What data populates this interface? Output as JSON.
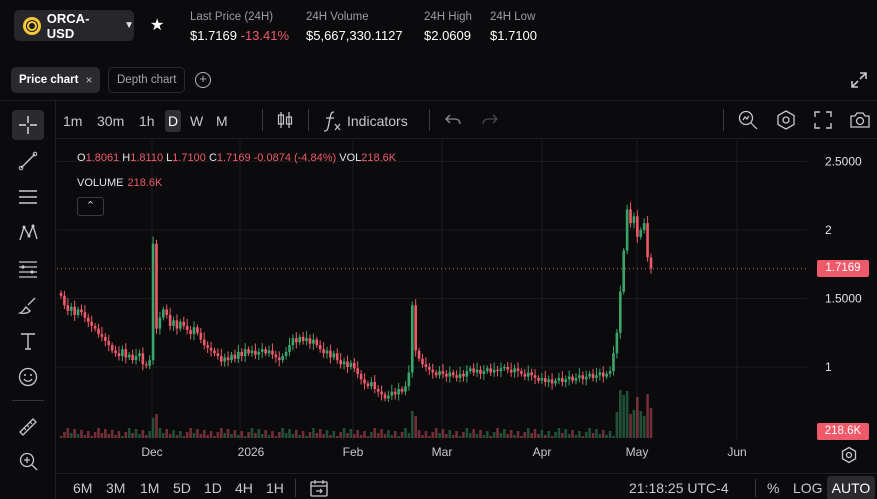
{
  "header": {
    "market": "ORCA-USD",
    "stats": [
      {
        "label": "Last Price (24H)",
        "value": "$1.7169",
        "change": "-13.41%"
      },
      {
        "label": "24H Volume",
        "value": "$5,667,330.1127"
      },
      {
        "label": "24H High",
        "value": "$2.0609"
      },
      {
        "label": "24H Low",
        "value": "$1.7100"
      }
    ]
  },
  "tabs": {
    "price": "Price chart",
    "depth": "Depth chart",
    "close": "×"
  },
  "toolbar": {
    "timeframes": [
      "1m",
      "30m",
      "1h",
      "D",
      "W",
      "M"
    ],
    "selected": "D",
    "indicators": "Indicators"
  },
  "legend": {
    "o_key": "O",
    "o_val": "1.8061",
    "h_key": "H",
    "h_val": "1.8110",
    "l_key": "L",
    "l_val": "1.7100",
    "c_key": "C",
    "c_val": "1.7169",
    "change": "-0.0874 (-4.84%)",
    "vol_key": "VOL",
    "vol_val": "218.6K",
    "volume_label": "VOLUME",
    "volume_val": "218.6K"
  },
  "price_tag": "1.7169",
  "volume_tag": "218.6K",
  "bottom": {
    "ranges": [
      "6M",
      "3M",
      "1M",
      "5D",
      "1D",
      "4H",
      "1H"
    ],
    "clock": "21:18:25 UTC-4",
    "percent": "%",
    "log": "LOG",
    "auto": "AUTO"
  },
  "chart_data": {
    "type": "candlestick",
    "y_ticks": [
      "2.5000",
      "2",
      "1.5000",
      "1"
    ],
    "x_ticks": [
      "Dec",
      "2026",
      "Feb",
      "Mar",
      "Apr",
      "May",
      "Jun"
    ],
    "last_price": 1.7169,
    "colors": {
      "up": "#3aa56a",
      "down": "#ef5a6a",
      "grid": "#1c1c20"
    },
    "closes": [
      1.52,
      1.45,
      1.41,
      1.44,
      1.38,
      1.42,
      1.4,
      1.36,
      1.33,
      1.3,
      1.28,
      1.24,
      1.22,
      1.19,
      1.16,
      1.12,
      1.1,
      1.08,
      1.13,
      1.07,
      1.09,
      1.05,
      1.08,
      1.1,
      1.02,
      1.01,
      1.05,
      1.9,
      1.28,
      1.36,
      1.42,
      1.38,
      1.3,
      1.34,
      1.28,
      1.33,
      1.3,
      1.27,
      1.24,
      1.29,
      1.25,
      1.2,
      1.16,
      1.14,
      1.12,
      1.1,
      1.08,
      1.04,
      1.07,
      1.05,
      1.09,
      1.06,
      1.11,
      1.08,
      1.13,
      1.1,
      1.12,
      1.09,
      1.11,
      1.13,
      1.1,
      1.12,
      1.09,
      1.07,
      1.05,
      1.08,
      1.11,
      1.16,
      1.21,
      1.18,
      1.22,
      1.19,
      1.21,
      1.17,
      1.2,
      1.16,
      1.13,
      1.1,
      1.12,
      1.07,
      1.1,
      1.05,
      1.02,
      1.04,
      1.0,
      1.03,
      0.99,
      0.95,
      0.91,
      0.88,
      0.86,
      0.89,
      0.84,
      0.82,
      0.8,
      0.77,
      0.79,
      0.82,
      0.8,
      0.84,
      0.82,
      0.86,
      0.96,
      1.45,
      1.12,
      1.06,
      1.02,
      1.0,
      0.98,
      0.96,
      0.94,
      0.97,
      0.95,
      0.93,
      0.96,
      0.94,
      0.92,
      0.95,
      0.93,
      0.97,
      0.99,
      0.96,
      0.98,
      0.95,
      0.97,
      0.99,
      0.96,
      0.98,
      0.97,
      0.99,
      1.0,
      0.98,
      0.96,
      0.99,
      0.97,
      0.95,
      0.93,
      0.96,
      0.94,
      0.92,
      0.9,
      0.92,
      0.89,
      0.91,
      0.88,
      0.9,
      0.92,
      0.89,
      0.91,
      0.93,
      0.9,
      0.92,
      0.94,
      0.91,
      0.93,
      0.95,
      0.92,
      0.94,
      0.96,
      0.93,
      0.95,
      0.97,
      1.1,
      1.25,
      1.55,
      1.85,
      2.15,
      2.05,
      2.1,
      1.95,
      2.0,
      2.05,
      1.8,
      1.72
    ]
  }
}
